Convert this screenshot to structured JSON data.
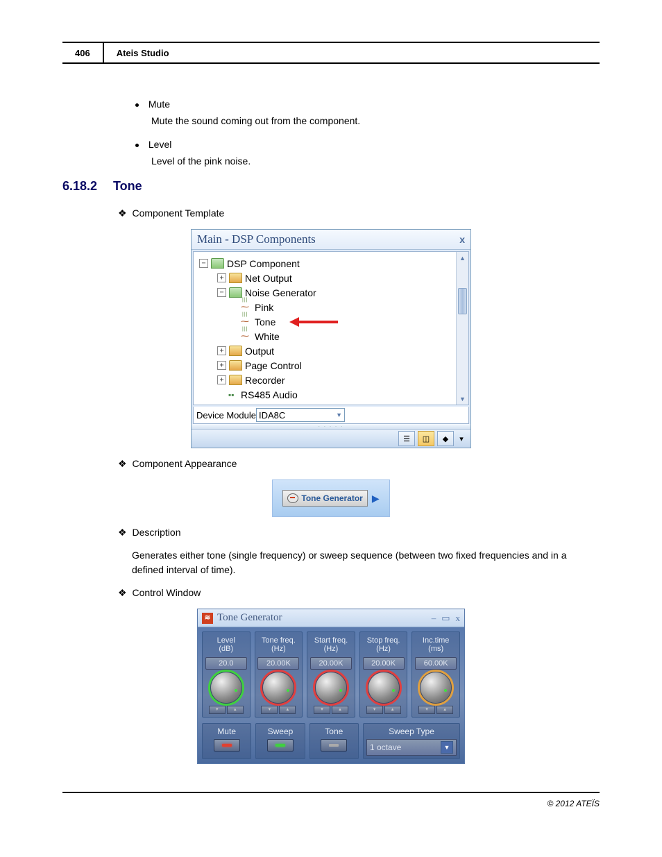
{
  "header": {
    "page_number": "406",
    "title": "Ateis Studio"
  },
  "bullets": [
    {
      "label": "Mute",
      "desc": "Mute the sound coming out from the component."
    },
    {
      "label": "Level",
      "desc": "Level of the pink noise."
    }
  ],
  "section": {
    "number": "6.18.2",
    "title": "Tone"
  },
  "headings": {
    "template": "Component Template",
    "appearance": "Component Appearance",
    "description": "Description",
    "control": "Control Window"
  },
  "dsp_panel": {
    "title": "Main - DSP Components",
    "tree": {
      "root": "DSP Component",
      "net_output": "Net Output",
      "noise_gen": "Noise Generator",
      "pink": "Pink",
      "tone": "Tone",
      "white": "White",
      "output": "Output",
      "page_control": "Page Control",
      "recorder": "Recorder",
      "rs485": "RS485 Audio"
    },
    "device_label": "Device Module",
    "device_value": "IDA8C"
  },
  "tone_component": {
    "label": "Tone Generator"
  },
  "description_text": "Generates either tone (single frequency) or sweep sequence (between two fixed frequencies and in a defined interval of time).",
  "control_window": {
    "title": "Tone Generator",
    "knobs": [
      {
        "label": "Level\n(dB)",
        "value": "20.0",
        "ring": "green"
      },
      {
        "label": "Tone freq.\n(Hz)",
        "value": "20.00K",
        "ring": "red"
      },
      {
        "label": "Start freq.\n(Hz)",
        "value": "20.00K",
        "ring": "red"
      },
      {
        "label": "Stop freq.\n(Hz)",
        "value": "20.00K",
        "ring": "red"
      },
      {
        "label": "Inc.time\n(ms)",
        "value": "60.00K",
        "ring": "yellow"
      }
    ],
    "buttons": {
      "mute": "Mute",
      "sweep": "Sweep",
      "tone": "Tone",
      "sweep_type": "Sweep Type"
    },
    "sweep_value": "1 octave"
  },
  "footer": "© 2012 ATEÏS"
}
